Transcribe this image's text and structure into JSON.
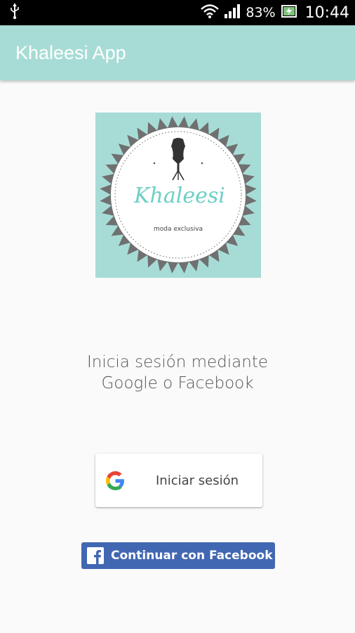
{
  "status_bar": {
    "battery_percent": "83%",
    "time": "10:44",
    "icons": [
      "usb-icon",
      "wifi-icon",
      "signal-icon",
      "battery-charging-icon"
    ]
  },
  "app_bar": {
    "title": "Khaleesi App",
    "color": "#a7dcd6"
  },
  "logo": {
    "brand_name": "Khaleesi",
    "tagline": "moda exclusiva",
    "background_color": "#a7dcd6",
    "icon": "dress-form-icon"
  },
  "prompt": {
    "line1": "Inicia sesión mediante",
    "line2": "Google o Facebook"
  },
  "google_button": {
    "label": "Iniciar sesión",
    "icon": "google-icon"
  },
  "facebook_button": {
    "label": "Continuar con Facebook",
    "icon": "facebook-icon",
    "color": "#4267b2"
  }
}
